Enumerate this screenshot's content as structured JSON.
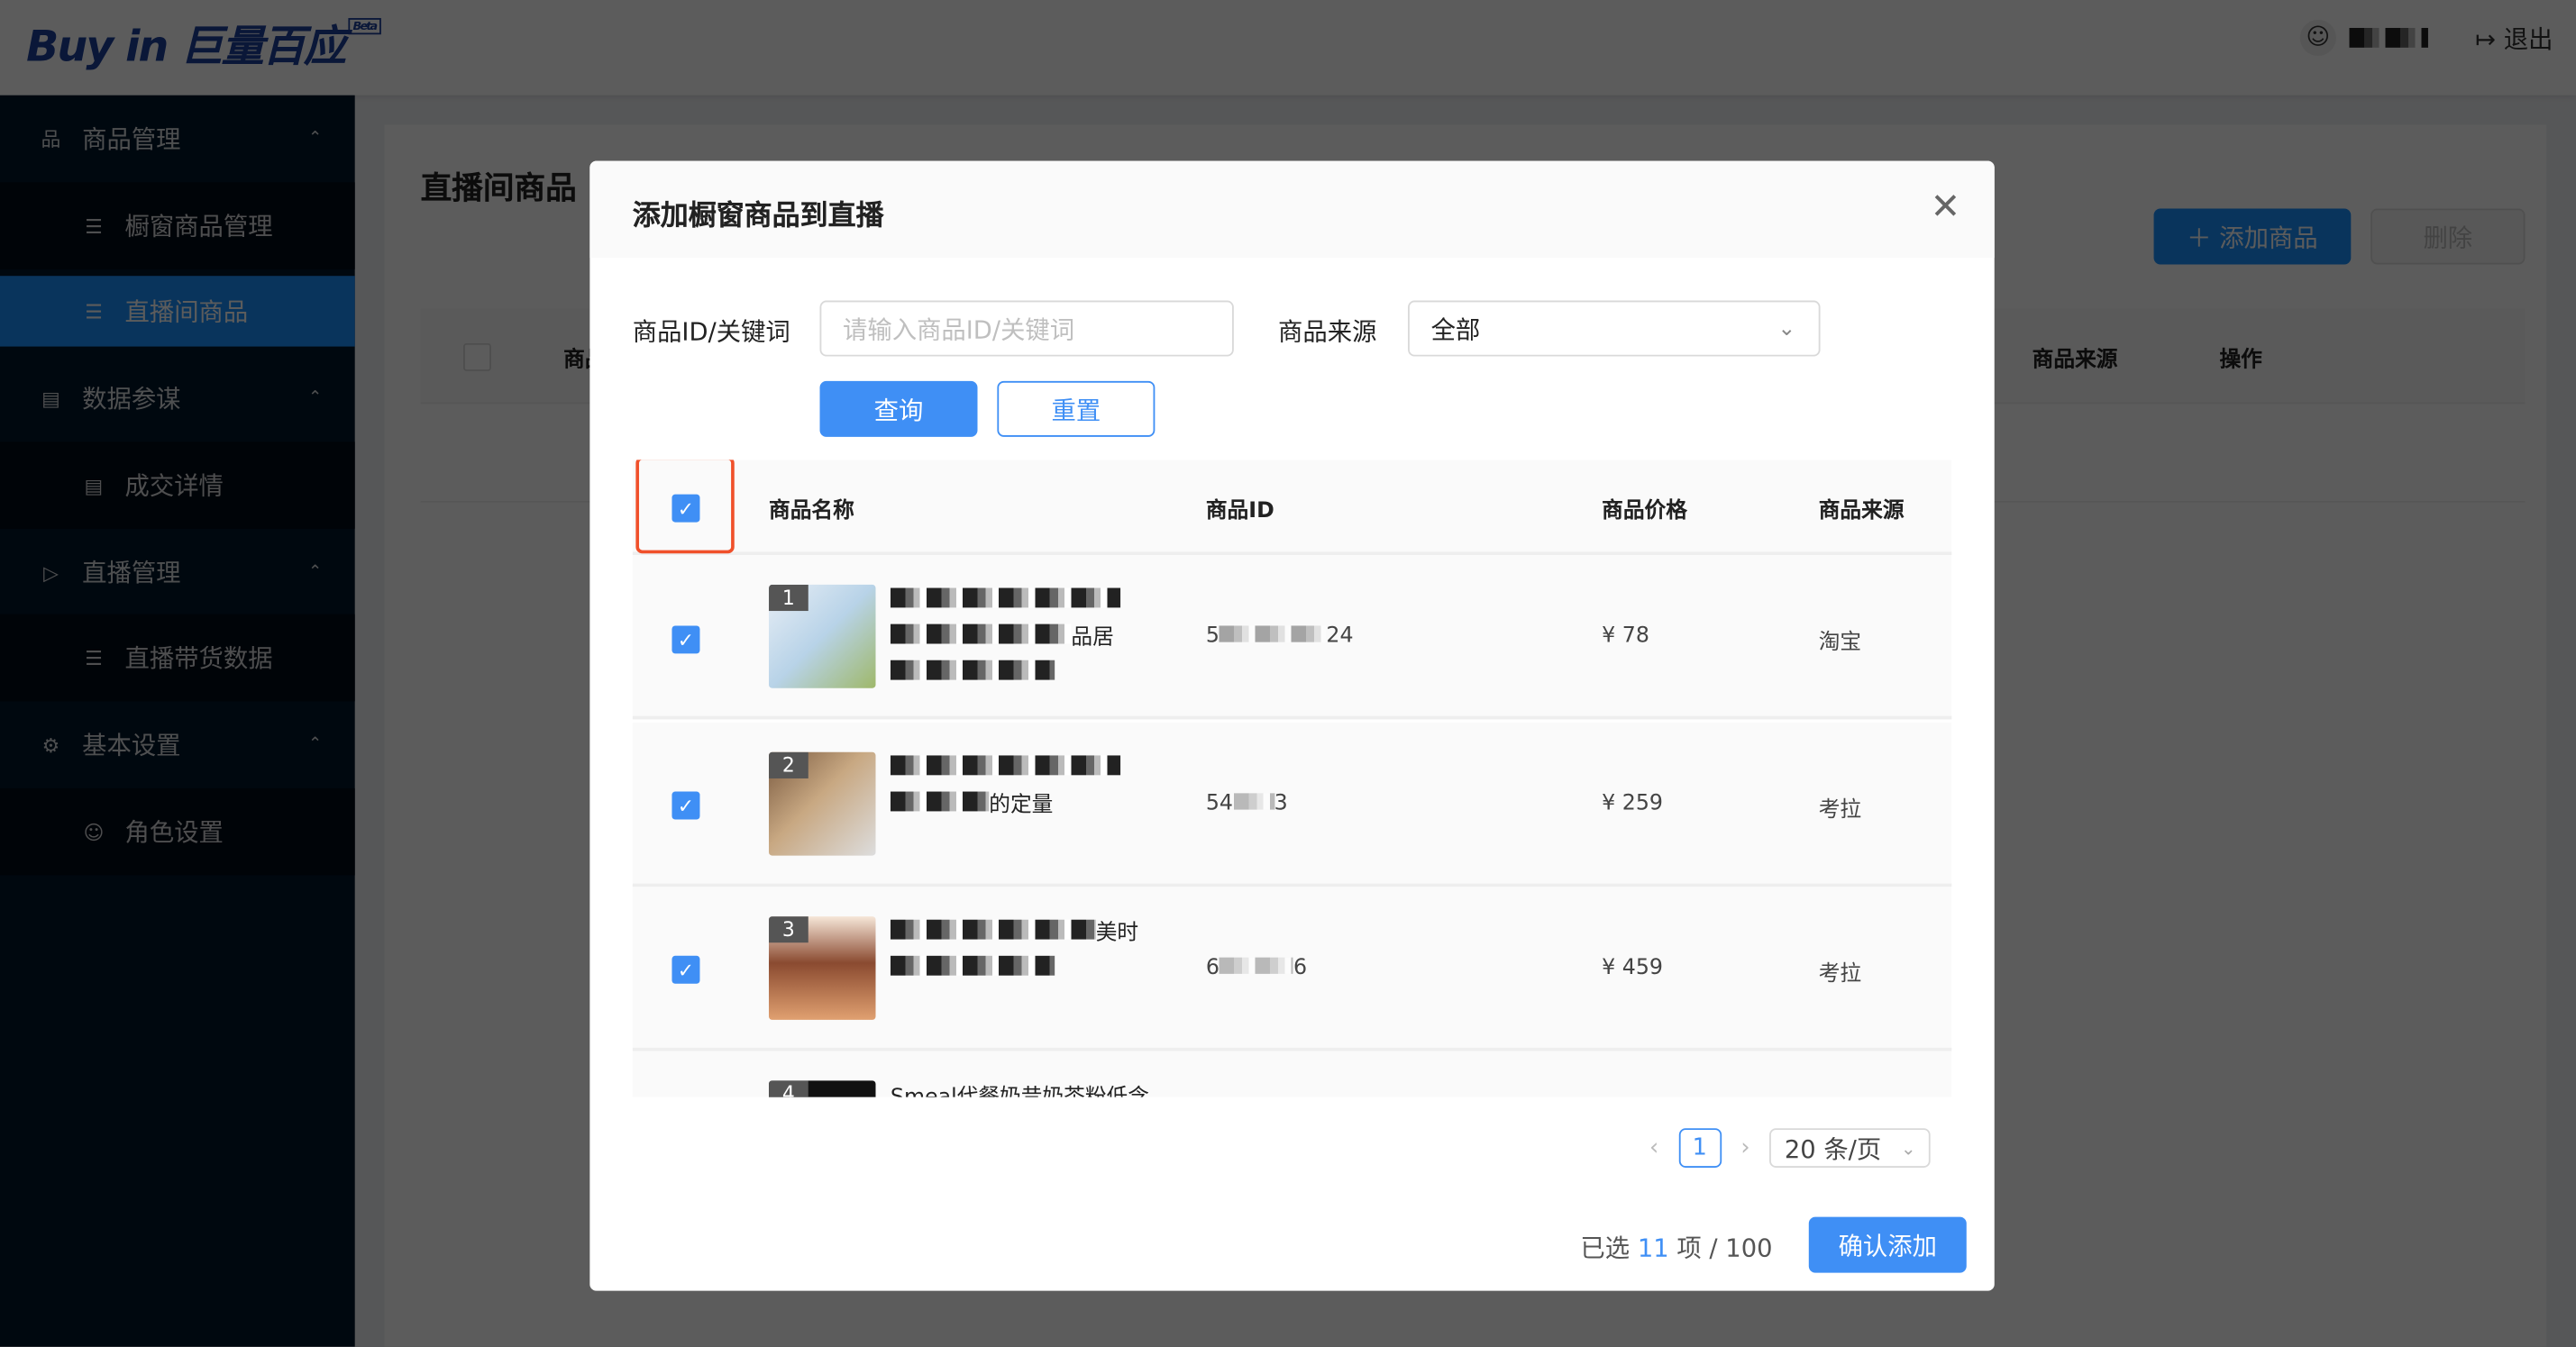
{
  "header": {
    "logo": "Buy in 巨量百应",
    "logo_badge": "Beta",
    "logout": "退出"
  },
  "sidebar": {
    "items": [
      {
        "label": "商品管理",
        "icon": "product-icon"
      },
      {
        "label": "橱窗商品管理",
        "icon": "list-icon"
      },
      {
        "label": "直播间商品",
        "icon": "list-icon",
        "selected": true
      },
      {
        "label": "数据参谋",
        "icon": "bar-chart-icon"
      },
      {
        "label": "成交详情",
        "icon": "document-icon"
      },
      {
        "label": "直播管理",
        "icon": "video-icon"
      },
      {
        "label": "直播带货数据",
        "icon": "list-icon"
      },
      {
        "label": "基本设置",
        "icon": "gear-icon"
      },
      {
        "label": "角色设置",
        "icon": "user-icon"
      }
    ]
  },
  "page": {
    "title": "直播间商品",
    "add_button": "添加商品",
    "delete_button": "删除",
    "table_headers": {
      "name": "商品名称",
      "source": "商品来源",
      "action": "操作"
    }
  },
  "modal": {
    "title": "添加橱窗商品到直播",
    "keyword_label": "商品ID/关键词",
    "keyword_placeholder": "请输入商品ID/关键词",
    "keyword_value": "",
    "source_label": "商品来源",
    "source_value": "全部",
    "query_button": "查询",
    "reset_button": "重置",
    "headers": {
      "name": "商品名称",
      "id": "商品ID",
      "price": "商品价格",
      "source": "商品来源"
    },
    "rows": [
      {
        "index": "1",
        "name_visible": "品居",
        "id_visible_start": "5",
        "id_visible_end": "24",
        "price": "¥ 78",
        "source": "淘宝",
        "checked": true
      },
      {
        "index": "2",
        "name_visible": "的定量",
        "id_visible_start": "54",
        "id_visible_end": "3",
        "price": "¥ 259",
        "source": "考拉",
        "checked": true
      },
      {
        "index": "3",
        "name_visible": "美时",
        "id_visible_start": "6",
        "id_visible_end": "6",
        "price": "¥ 459",
        "source": "考拉",
        "checked": true
      },
      {
        "index": "4",
        "name_visible": "Smeal代餐奶昔奶茶粉低含"
      }
    ],
    "pagination": {
      "current": "1",
      "page_size": "20 条/页"
    },
    "selected_prefix": "已选",
    "selected_count": "11",
    "selected_suffix": "项 / 100",
    "confirm_button": "确认添加"
  },
  "colors": {
    "primary": "#3f8ff5",
    "highlight_border": "#f0502a",
    "sidebar_bg": "#001529"
  }
}
